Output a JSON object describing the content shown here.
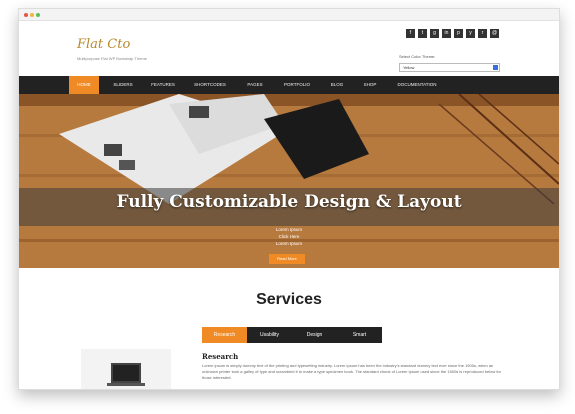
{
  "window": {
    "dots": [
      "#e9544a",
      "#f6b23a",
      "#5ac05a"
    ]
  },
  "header": {
    "logo_text": "Flat Cto",
    "tagline": "Multipurpose Flat WP Bootstrap Theme",
    "socials": [
      {
        "icon": "facebook-icon",
        "glyph": "f"
      },
      {
        "icon": "twitter-icon",
        "glyph": "t"
      },
      {
        "icon": "google-plus-icon",
        "glyph": "g"
      },
      {
        "icon": "linkedin-icon",
        "glyph": "in"
      },
      {
        "icon": "pinterest-icon",
        "glyph": "p"
      },
      {
        "icon": "youtube-icon",
        "glyph": "y"
      },
      {
        "icon": "rss-icon",
        "glyph": "r"
      },
      {
        "icon": "email-icon",
        "glyph": "@"
      }
    ],
    "switcher_label": "Select Color Theme:",
    "switcher_value": "Yellow"
  },
  "nav": {
    "items": [
      "Home",
      "Sliders",
      "Features",
      "Shortcodes",
      "Pages",
      "Portfolio",
      "Blog",
      "Shop",
      "Documentation"
    ],
    "active_index": 0,
    "accent": "#f08a24"
  },
  "hero": {
    "title": "Fully Customizable Design & Layout",
    "sub_lines": [
      "Lorem Ipsum",
      "Click Here",
      "Lorem Ipsum"
    ],
    "button": "Read More"
  },
  "services": {
    "title": "Services",
    "tabs": [
      "Research",
      "Usability",
      "Design",
      "Smart"
    ],
    "active_tab": 0,
    "heading": "Research",
    "body": "Lorem ipsum is simply dummy text of the printing and typesetting industry. Lorem Ipsum has been the industry's standard dummy text ever since the 1500s, when an unknown printer took a galley of type and scrambled it to make a type specimen book. The standard chunk of Lorem Ipsum used since the 1500s is reproduced below for those interested."
  }
}
